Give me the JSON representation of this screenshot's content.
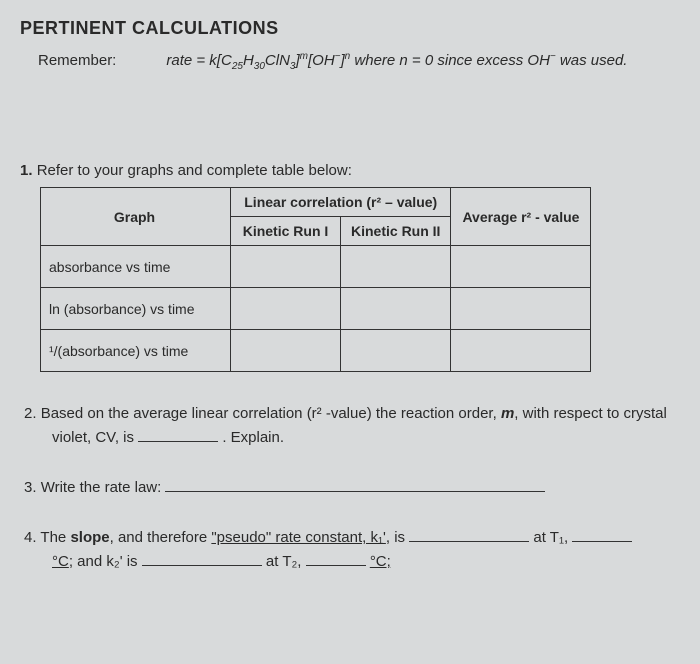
{
  "heading": "PERTINENT CALCULATIONS",
  "remember": {
    "label": "Remember:",
    "formula_prefix": "rate = k[C",
    "sub1": "25",
    "mid1": "H",
    "sub2": "30",
    "mid2": "ClN",
    "sub3": "3",
    "mid3": "]",
    "sup1": "m",
    "mid4": "[OH",
    "sup2": "−",
    "mid5": "]",
    "sup3": "n",
    "where": "  where n = 0 since excess OH",
    "sup4": "−",
    "tail": " was used."
  },
  "q1": {
    "num": "1.",
    "text": "Refer to your graphs and complete table below:"
  },
  "table": {
    "header_linear": "Linear correlation (r² – value)",
    "col_graph": "Graph",
    "col_run1": "Kinetic Run I",
    "col_run2": "Kinetic Run II",
    "col_avg": "Average r² - value",
    "rows": [
      "absorbance vs time",
      "ln (absorbance) vs time",
      "¹/(absorbance) vs time"
    ]
  },
  "q2": {
    "num": "2.",
    "text1": "Based on the average linear correlation (r² -value) the reaction order, ",
    "m": "m",
    "text2": ", with respect to crystal",
    "text3": "violet, CV, is",
    "explain": ". Explain."
  },
  "q3": {
    "num": "3.",
    "text": "Write the rate law:"
  },
  "q4": {
    "num": "4.",
    "text1": "The ",
    "slope": "slope",
    "text2": ", and therefore ",
    "pseudo": "\"pseudo\" rate constant, k₁'",
    "text3": ", is",
    "at_t1": "at T₁,",
    "c1": "°C",
    "and_k2": "; and k₂' is",
    "at_t2": "at T₂,",
    "c2": "°C;"
  }
}
